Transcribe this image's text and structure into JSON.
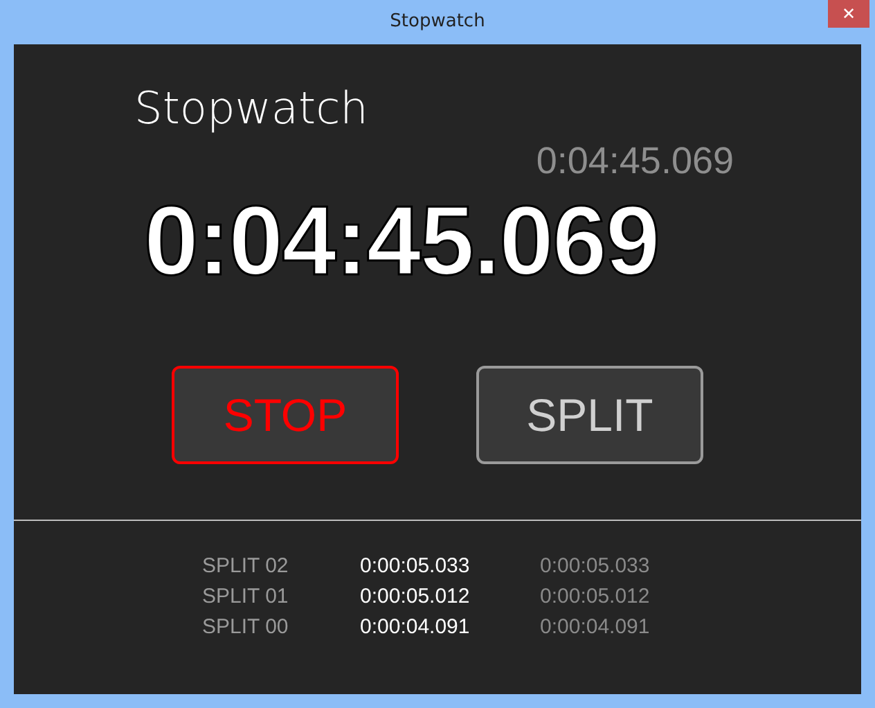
{
  "window": {
    "title": "Stopwatch",
    "close": "✕"
  },
  "heading": "Stopwatch",
  "lap_time": "0:04:45.069",
  "total_time": "0:04:45.069",
  "buttons": [
    {
      "label": "STOP",
      "kind": "stop"
    },
    {
      "label": "SPLIT",
      "kind": "split"
    }
  ],
  "splits": [
    {
      "name": "SPLIT 02",
      "time": "0:00:05.033",
      "total": "0:00:05.033"
    },
    {
      "name": "SPLIT 01",
      "time": "0:00:05.012",
      "total": "0:00:05.012"
    },
    {
      "name": "SPLIT 00",
      "time": "0:00:04.091",
      "total": "0:00:04.091"
    }
  ]
}
